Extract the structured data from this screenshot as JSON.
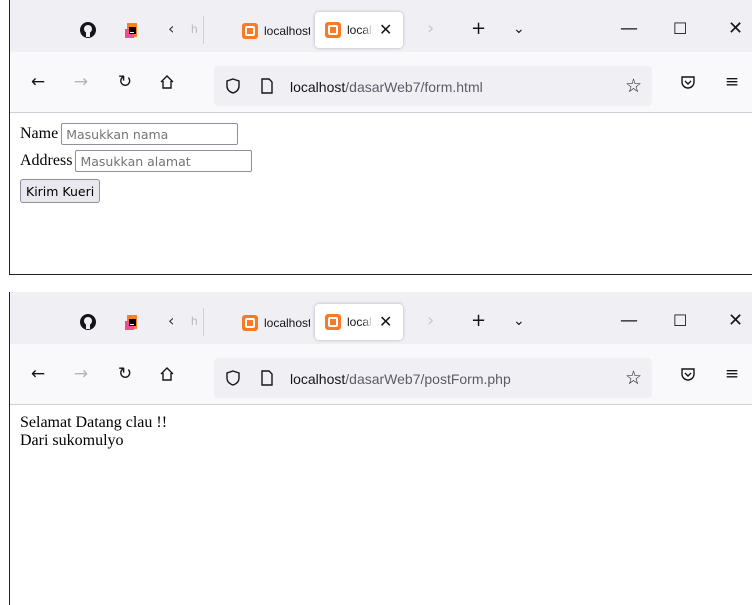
{
  "windows": [
    {
      "tabs": [
        {
          "label": "localhost",
          "active": false
        },
        {
          "label": "localhost",
          "active": true
        }
      ],
      "tab_close_glyph": "✕",
      "url_host": "localhost",
      "url_path": "/dasarWeb7/form.html",
      "page": {
        "name_label": "Name",
        "name_placeholder": "Masukkan nama",
        "address_label": "Address",
        "address_placeholder": "Masukkan alamat",
        "submit_label": "Kirim Kueri"
      }
    },
    {
      "tabs": [
        {
          "label": "localhost",
          "active": false
        },
        {
          "label": "localhost",
          "active": true
        }
      ],
      "tab_close_glyph": "✕",
      "url_host": "localhost",
      "url_path": "/dasarWeb7/postForm.php",
      "page": {
        "line1": "Selamat Datang clau !!",
        "line2": "Dari sukomulyo"
      }
    }
  ],
  "icons": {
    "pinned": [
      "github-icon",
      "jetbrains-icon"
    ],
    "toolbar": [
      "new-tab-plus-icon",
      "list-all-tabs-chevron-icon",
      "minimize-icon",
      "maximize-icon",
      "close-window-icon"
    ],
    "nav": [
      "back-arrow-icon",
      "forward-arrow-icon",
      "reload-icon",
      "home-icon",
      "shield-icon",
      "page-icon",
      "star-icon",
      "pocket-icon",
      "menu-icon"
    ]
  },
  "colors": {
    "tab_bar": "#f0f0f4",
    "nav_bar": "#f9f9fb",
    "url_bar": "#f0f0f4",
    "favicon": "#fb7a24",
    "button_bg": "#e9e9ed"
  }
}
